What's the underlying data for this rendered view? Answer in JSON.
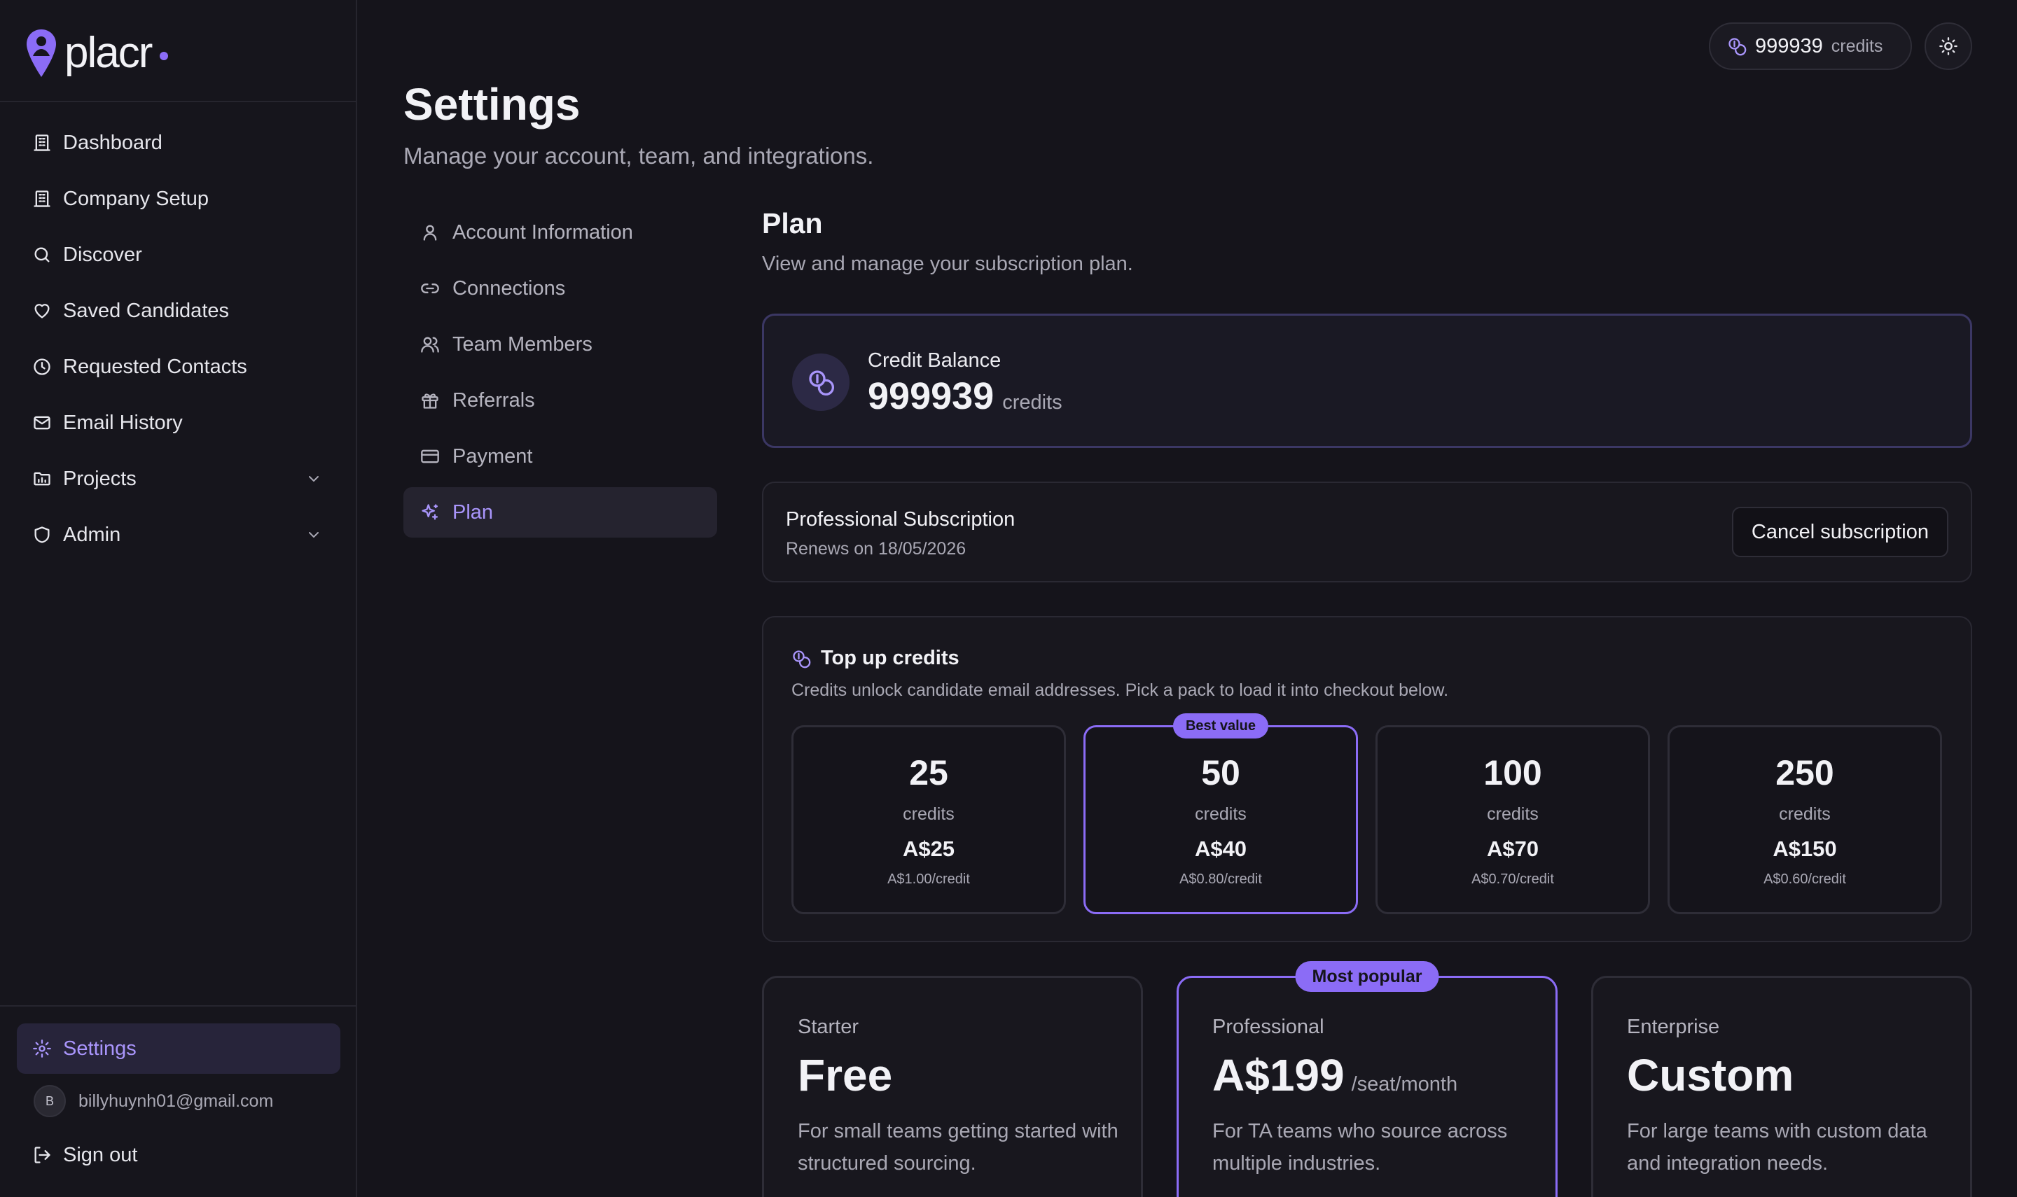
{
  "brand": {
    "name": "placr",
    "accent": "#8b6cf6"
  },
  "sidebar": {
    "items": [
      {
        "label": "Dashboard",
        "icon": "building-icon"
      },
      {
        "label": "Company Setup",
        "icon": "building-icon"
      },
      {
        "label": "Discover",
        "icon": "search-icon"
      },
      {
        "label": "Saved Candidates",
        "icon": "heart-icon"
      },
      {
        "label": "Requested Contacts",
        "icon": "clock-icon"
      },
      {
        "label": "Email History",
        "icon": "mail-icon"
      },
      {
        "label": "Projects",
        "icon": "folder-chart-icon"
      },
      {
        "label": "Admin",
        "icon": "shield-icon"
      }
    ],
    "settings_label": "Settings",
    "user_initial": "B",
    "user_email": "billyhuynh01@gmail.com",
    "signout_label": "Sign out"
  },
  "topbar": {
    "credits": "999939",
    "credits_label": "credits"
  },
  "header": {
    "title": "Settings",
    "subtitle": "Manage your account, team, and integrations."
  },
  "settings_nav": [
    {
      "label": "Account Information",
      "icon": "user-icon"
    },
    {
      "label": "Connections",
      "icon": "link-icon"
    },
    {
      "label": "Team Members",
      "icon": "users-icon"
    },
    {
      "label": "Referrals",
      "icon": "gift-icon"
    },
    {
      "label": "Payment",
      "icon": "credit-card-icon"
    },
    {
      "label": "Plan",
      "icon": "sparkles-icon",
      "active": true
    }
  ],
  "plan": {
    "title": "Plan",
    "subtitle": "View and manage your subscription plan.",
    "balance": {
      "label": "Credit Balance",
      "value": "999939",
      "unit": "credits"
    },
    "subscription": {
      "name": "Professional Subscription",
      "renews": "Renews on 18/05/2026",
      "cancel_label": "Cancel subscription"
    },
    "topup": {
      "title": "Top up credits",
      "subtitle": "Credits unlock candidate email addresses. Pick a pack to load it into checkout below.",
      "packs": [
        {
          "credits": "25",
          "unit": "credits",
          "price": "A$25",
          "per": "A$1.00/credit"
        },
        {
          "credits": "50",
          "unit": "credits",
          "price": "A$40",
          "per": "A$0.80/credit",
          "badge": "Best value"
        },
        {
          "credits": "100",
          "unit": "credits",
          "price": "A$70",
          "per": "A$0.70/credit"
        },
        {
          "credits": "250",
          "unit": "credits",
          "price": "A$150",
          "per": "A$0.60/credit"
        }
      ]
    },
    "tiers": [
      {
        "name": "Starter",
        "price": "Free",
        "unit": "",
        "desc": "For small teams getting started with structured sourcing."
      },
      {
        "name": "Professional",
        "price": "A$199",
        "unit": "/seat/month",
        "desc": "For TA teams who source across multiple industries.",
        "badge": "Most popular"
      },
      {
        "name": "Enterprise",
        "price": "Custom",
        "unit": "",
        "desc": "For large teams with custom data and integration needs."
      }
    ]
  }
}
